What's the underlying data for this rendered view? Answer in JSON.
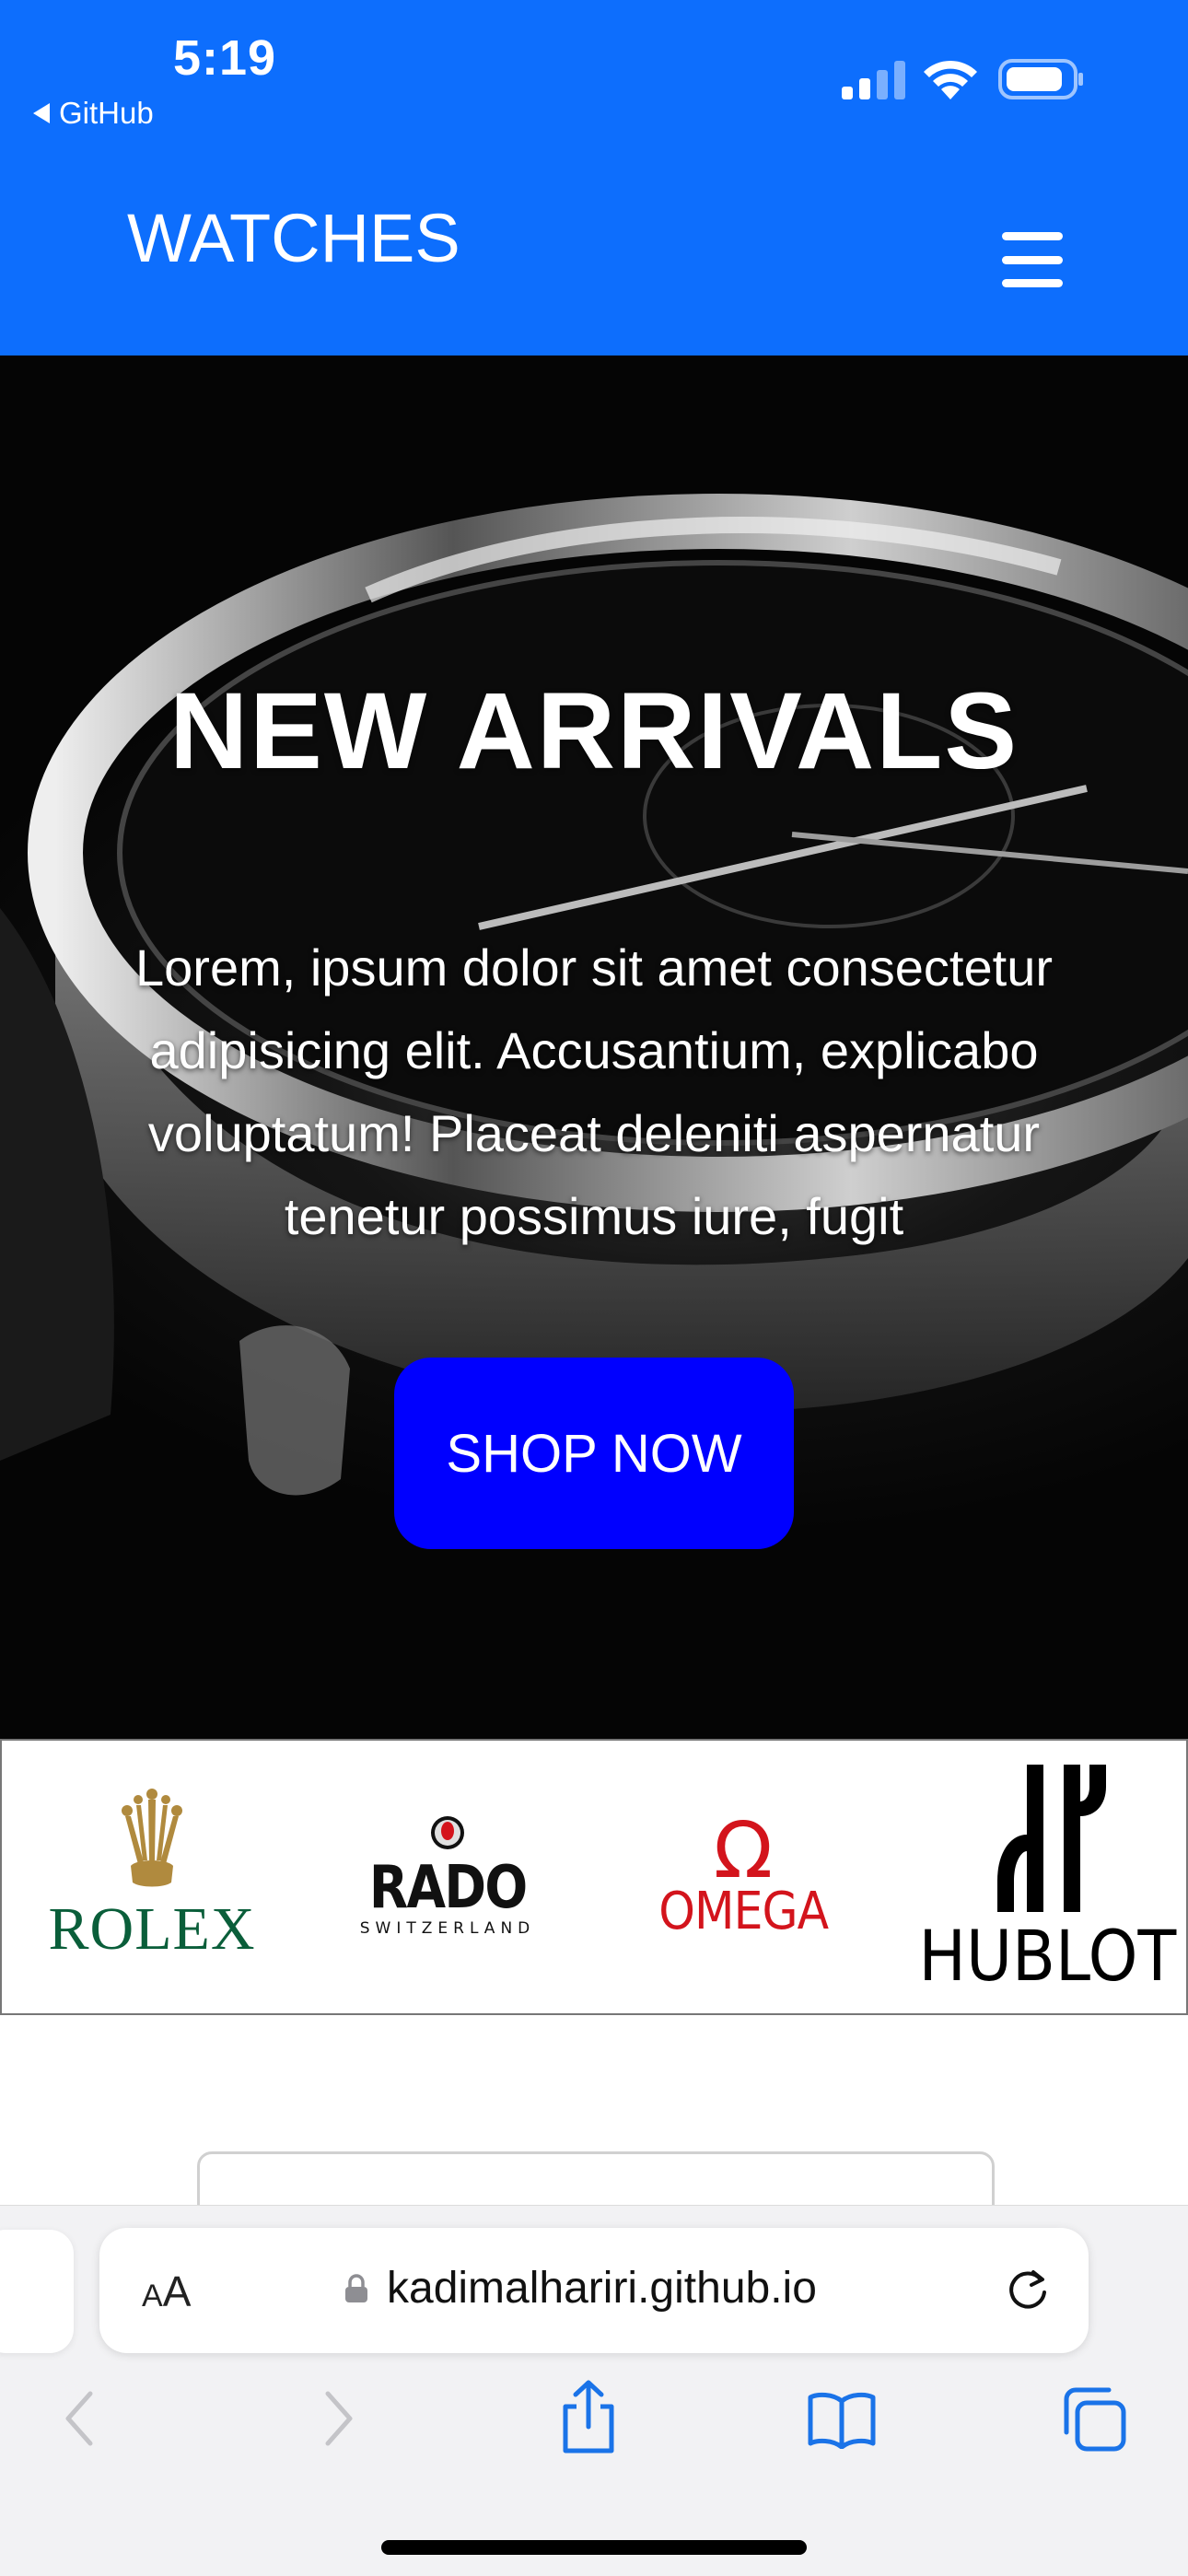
{
  "status_bar": {
    "time": "5:19",
    "back_label": "GitHub",
    "icons": [
      "cellular-signal-icon",
      "wifi-icon",
      "battery-icon"
    ]
  },
  "navbar": {
    "brand": "WATCHES",
    "menu_icon": "hamburger-menu-icon",
    "background": "#0d6efd"
  },
  "hero": {
    "title": "NEW ARRIVALS",
    "text": "Lorem, ipsum dolor sit amet consectetur adipisicing elit. Accusantium, explicabo voluptatum! Placeat deleniti aspernatur tenetur possimus iure, fugit",
    "button_label": "SHOP NOW",
    "button_color": "#0000ff"
  },
  "brands": {
    "rolex": "ROLEX",
    "rado": "RADO",
    "rado_sub": "SWITZERLAND",
    "omega_symbol": "Ω",
    "omega": "OMEGA",
    "hublot": "HUBLOT"
  },
  "browser": {
    "text_size_small": "A",
    "text_size_big": "A",
    "url": "kadimalhariri.github.io",
    "toolbar_icons": [
      "back-arrow-icon",
      "forward-arrow-icon",
      "share-icon",
      "bookmarks-icon",
      "tabs-icon"
    ]
  }
}
